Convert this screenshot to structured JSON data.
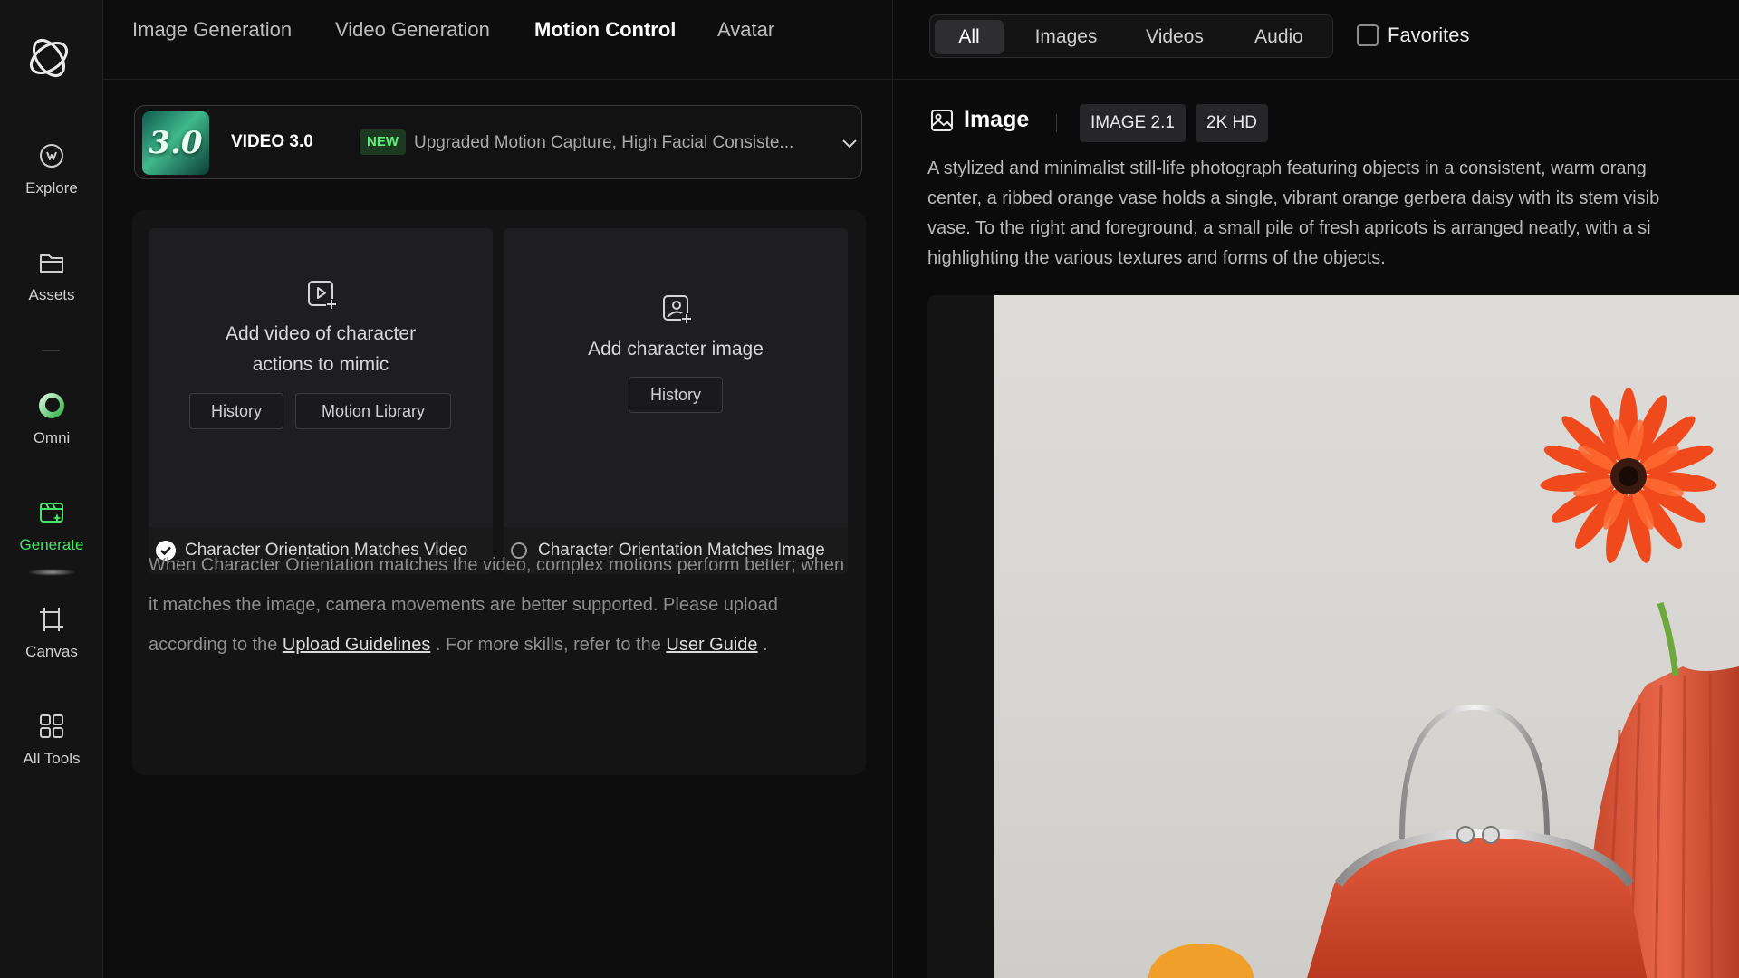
{
  "sidebar": {
    "items": [
      {
        "label": "Explore",
        "icon": "explore-icon"
      },
      {
        "label": "Assets",
        "icon": "folder-icon"
      },
      {
        "label": "Omni",
        "icon": "omni-icon"
      },
      {
        "label": "Generate",
        "icon": "generate-icon",
        "active": true
      },
      {
        "label": "Canvas",
        "icon": "canvas-icon"
      },
      {
        "label": "All Tools",
        "icon": "grid-icon"
      }
    ],
    "accent": "#49e36b"
  },
  "topnav": {
    "tabs": [
      {
        "label": "Image Generation"
      },
      {
        "label": "Video Generation"
      },
      {
        "label": "Motion Control",
        "active": true
      },
      {
        "label": "Avatar"
      }
    ]
  },
  "model": {
    "thumb_text": "3.0",
    "name": "VIDEO 3.0",
    "badge": "NEW",
    "description": "Upgraded Motion Capture, High Facial Consiste..."
  },
  "upload": {
    "video_card": {
      "line1": "Add video of character",
      "line2": "actions to mimic",
      "history": "History",
      "library": "Motion Library",
      "orientation": "Character Orientation Matches Video"
    },
    "image_card": {
      "label": "Add character image",
      "history": "History",
      "orientation": "Character Orientation Matches Image"
    },
    "hint": {
      "text1": "When Character Orientation matches the video, complex motions perform better; when it matches the image, camera movements are better supported. Please upload according to the ",
      "link1": "Upload Guidelines",
      "text2": " . For more skills, refer to the ",
      "link2": "User Guide",
      "text3": " ."
    }
  },
  "filters": {
    "options": [
      {
        "label": "All",
        "active": true
      },
      {
        "label": "Images"
      },
      {
        "label": "Videos"
      },
      {
        "label": "Audio"
      }
    ],
    "favorites": "Favorites"
  },
  "result": {
    "title": "Image",
    "tags": [
      "IMAGE 2.1",
      "2K HD"
    ],
    "prompt_lines": [
      "A stylized and minimalist still-life photograph featuring objects in a consistent, warm orang",
      "center, a ribbed orange vase holds a single, vibrant orange gerbera daisy with its stem visib",
      "vase. To the right and foreground, a small pile of fresh apricots is arranged neatly, with a si",
      "highlighting the various textures and forms of the objects."
    ]
  }
}
